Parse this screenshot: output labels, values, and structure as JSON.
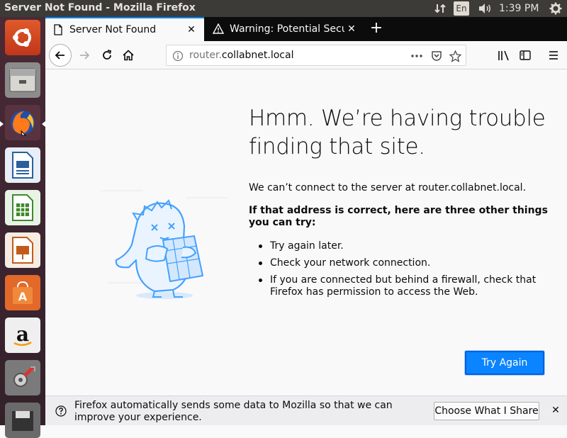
{
  "panel": {
    "window_title": "Server Not Found - Mozilla Firefox",
    "keyboard_layout": "En",
    "clock": "1:39 PM"
  },
  "launcher": {
    "items": [
      {
        "name": "ubuntu-dash-icon"
      },
      {
        "name": "files-icon"
      },
      {
        "name": "firefox-icon"
      },
      {
        "name": "libreoffice-writer-icon"
      },
      {
        "name": "libreoffice-calc-icon"
      },
      {
        "name": "libreoffice-impress-icon"
      },
      {
        "name": "software-center-icon"
      },
      {
        "name": "amazon-icon"
      },
      {
        "name": "system-settings-icon"
      },
      {
        "name": "floppy-save-icon"
      }
    ]
  },
  "tabs": [
    {
      "label": "Server Not Found",
      "active": true
    },
    {
      "label": "Warning: Potential Secu",
      "active": false
    }
  ],
  "urlbar": {
    "url_prefix": "router.",
    "url_domain": "collabnet.local"
  },
  "error": {
    "heading": "Hmm. We’re having trouble finding that site.",
    "message": "We can’t connect to the server at router.collabnet.local.",
    "suggest_intro": "If that address is correct, here are three other things you can try:",
    "suggestions": [
      "Try again later.",
      "Check your network connection.",
      "If you are connected but behind a firewall, check that Firefox has permission to access the Web."
    ],
    "try_again_label": "Try Again"
  },
  "notification": {
    "text": "Firefox automatically sends some data to Mozilla so that we can improve your experience.",
    "button_label": "Choose What I Share"
  },
  "colors": {
    "accent": "#0a84ff",
    "panel": "#3c3b37",
    "launcher": "#3a2430"
  }
}
